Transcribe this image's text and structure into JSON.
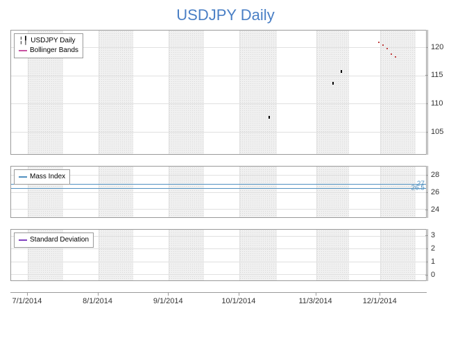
{
  "title": "USDJPY Daily",
  "x_axis": {
    "ticks": [
      "7/1/2014",
      "8/1/2014",
      "9/1/2014",
      "10/1/2014",
      "11/3/2014",
      "12/1/2014"
    ]
  },
  "panels": {
    "main": {
      "legend": [
        {
          "label": "USDJPY Daily",
          "type": "candle"
        },
        {
          "label": "Bollinger Bands",
          "color": "#c850a0"
        }
      ],
      "y_ticks": [
        105,
        110,
        115,
        120
      ],
      "y_range": [
        101,
        123
      ]
    },
    "mass": {
      "legend": [
        {
          "label": "Mass Index",
          "color": "#5090c0"
        }
      ],
      "y_ticks": [
        24,
        26,
        28
      ],
      "y_range": [
        23,
        29
      ],
      "ref_lines": [
        {
          "value": 27,
          "label": "27",
          "color": "#5090c0"
        },
        {
          "value": 26.5,
          "label": "26.5",
          "color": "#5090c0"
        }
      ]
    },
    "std": {
      "legend": [
        {
          "label": "Standard Deviation",
          "color": "#8040c0"
        }
      ],
      "y_ticks": [
        0,
        1,
        2,
        3
      ],
      "y_range": [
        -0.5,
        3.5
      ]
    }
  },
  "chart_data": [
    {
      "type": "line",
      "title": "USDJPY Daily",
      "xlabel": "",
      "ylabel": "",
      "ylim": [
        101,
        123
      ],
      "x": [
        "7/1/2014",
        "8/1/2014",
        "9/1/2014",
        "10/1/2014",
        "11/3/2014",
        "12/1/2014"
      ],
      "series": [
        {
          "name": "USDJPY Daily",
          "values": [
            null,
            null,
            null,
            108,
            114,
            120
          ]
        },
        {
          "name": "Bollinger Bands",
          "values": []
        }
      ],
      "visible_points": [
        {
          "date_frac": 0.62,
          "price": 108
        },
        {
          "date_frac": 0.775,
          "price": 114
        },
        {
          "date_frac": 0.795,
          "price": 116
        },
        {
          "date_frac": 0.885,
          "price": 121
        },
        {
          "date_frac": 0.895,
          "price": 120.5
        },
        {
          "date_frac": 0.905,
          "price": 120
        },
        {
          "date_frac": 0.915,
          "price": 119
        },
        {
          "date_frac": 0.925,
          "price": 118.5
        }
      ]
    },
    {
      "type": "line",
      "title": "Mass Index",
      "ylim": [
        23,
        29
      ],
      "reference_levels": [
        27,
        26.5
      ],
      "series": [
        {
          "name": "Mass Index",
          "values": []
        }
      ]
    },
    {
      "type": "line",
      "title": "Standard Deviation",
      "ylim": [
        -0.5,
        3.5
      ],
      "series": [
        {
          "name": "Standard Deviation",
          "values": []
        }
      ]
    }
  ]
}
